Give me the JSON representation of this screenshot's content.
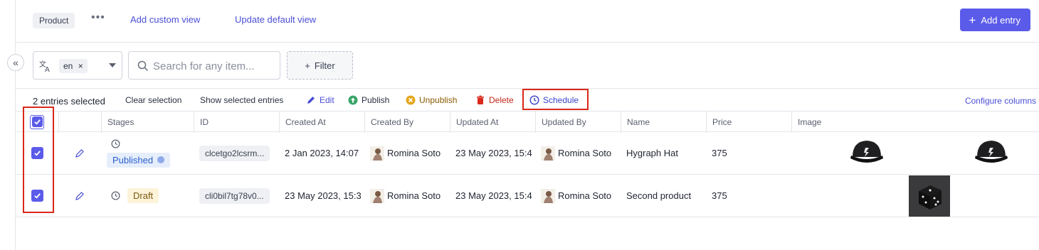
{
  "topbar": {
    "model_name": "Product",
    "more_label": "•••",
    "add_custom_view": "Add custom view",
    "update_default_view": "Update default view",
    "add_entry": "Add entry"
  },
  "filters": {
    "locale": "en",
    "search_placeholder": "Search for any item...",
    "filter_label": "Filter"
  },
  "actionbar": {
    "selected_count": "2 entries selected",
    "clear_selection": "Clear selection",
    "show_selected": "Show selected entries",
    "edit": "Edit",
    "publish": "Publish",
    "unpublish": "Unpublish",
    "delete": "Delete",
    "schedule": "Schedule",
    "configure_columns": "Configure columns"
  },
  "colors": {
    "accent": "#5b5bea",
    "publish": "#3aa66a",
    "unpublish": "#d99a10",
    "delete": "#d9281a",
    "highlight_outline": "#d9281a"
  },
  "table": {
    "headers": [
      "Stages",
      "ID",
      "Created At",
      "Created By",
      "Updated At",
      "Updated By",
      "Name",
      "Price",
      "Image"
    ],
    "rows": [
      {
        "selected": true,
        "stage": "Published",
        "id": "clcetgo2lcsrm...",
        "created_at": "2 Jan 2023, 14:07",
        "created_by": "Romina Soto",
        "updated_at": "23 May 2023, 15:4",
        "updated_by": "Romina Soto",
        "name": "Hygraph Hat",
        "price": "375",
        "images": [
          "cap-image",
          "cap-image"
        ]
      },
      {
        "selected": true,
        "stage": "Draft",
        "id": "cli0bil7tg78v0...",
        "created_at": "23 May 2023, 15:3",
        "created_by": "Romina Soto",
        "updated_at": "23 May 2023, 15:4",
        "updated_by": "Romina Soto",
        "name": "Second product",
        "price": "375",
        "images": [
          "dice-image"
        ]
      }
    ]
  }
}
